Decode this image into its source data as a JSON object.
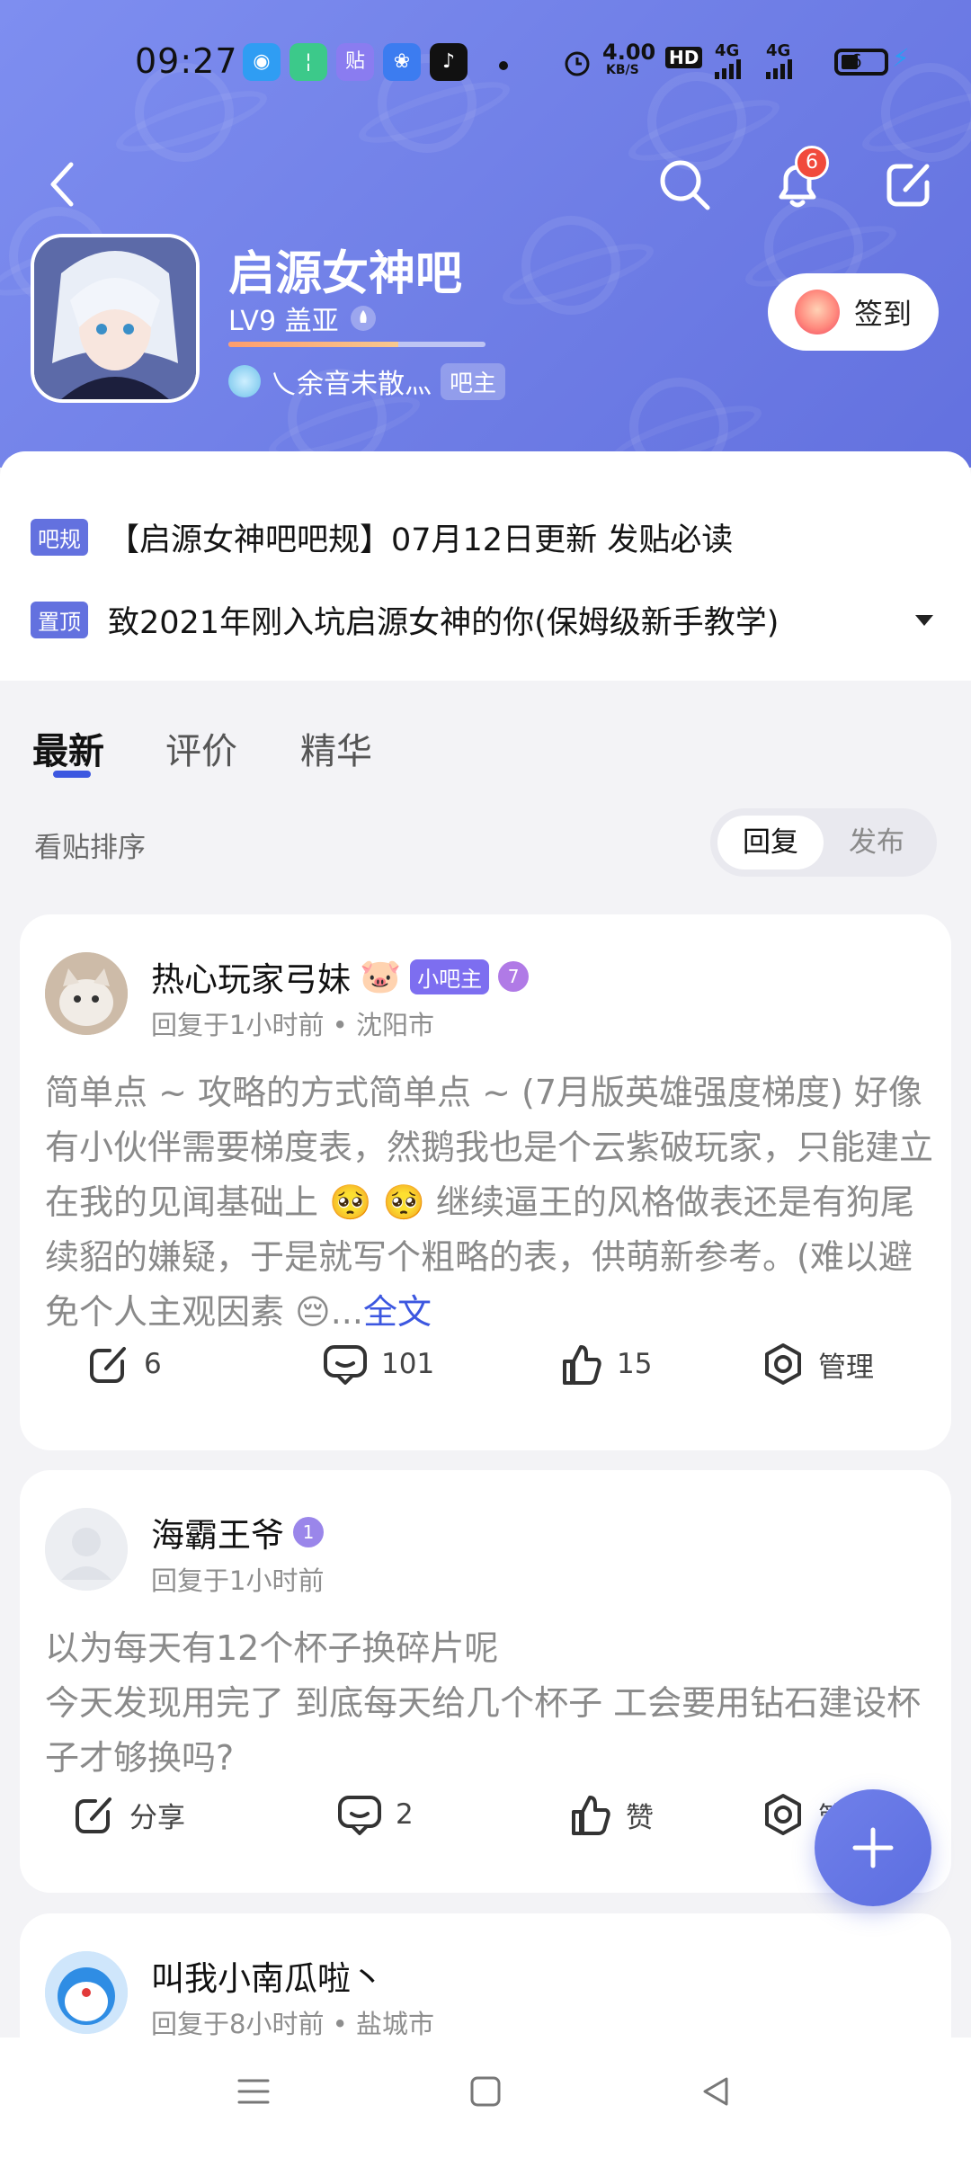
{
  "status": {
    "time": "09:27",
    "net_speed": "4.00",
    "net_unit": "KB/S",
    "hd": "HD",
    "sig1": "4G",
    "sig2": "4G",
    "battery": "6",
    "app_icons": [
      {
        "name": "app-blue-icon",
        "color": "#2f9df3",
        "glyph": "◉"
      },
      {
        "name": "app-green-icon",
        "color": "#3cc98a",
        "glyph": "¦"
      },
      {
        "name": "app-tieba-icon",
        "color": "#8a7cf0",
        "glyph": "贴"
      },
      {
        "name": "app-baidu-icon",
        "color": "#3c7cf0",
        "glyph": "❀"
      },
      {
        "name": "app-tiktok-icon",
        "color": "#111111",
        "glyph": "♪"
      }
    ]
  },
  "header": {
    "title": "启源女神吧",
    "level": "LV9 盖亚",
    "level_progress": 0.66,
    "admin_name": "乀余音未散灬",
    "admin_tag": "吧主",
    "notif_count": "6",
    "signin": "签到"
  },
  "notices": [
    {
      "tag": "吧规",
      "text": "【启源女神吧吧规】07月12日更新 发贴必读"
    },
    {
      "tag": "置顶",
      "text": "致2021年刚入坑启源女神的你(保姆级新手教学)"
    }
  ],
  "tabs": [
    "最新",
    "评价",
    "精华"
  ],
  "sort": {
    "label": "看贴排序",
    "options": [
      "回复",
      "发布"
    ]
  },
  "posts": [
    {
      "author": "热心玩家弓妹",
      "emoji": "🐷",
      "mod_tag": "小吧主",
      "level": "7",
      "level_color": "#b07ae6",
      "meta": "回复于1小时前 • 沈阳市",
      "body": "简单点 ~ 攻略的方式简单点 ~ (7月版英雄强度梯度) 好像有小伙伴需要梯度表，然鹅我也是个云紫破玩家，只能建立在我的见闻基础上 🥺 🥺 继续逼王的风格做表还是有狗尾续貂的嫌疑，于是就写个粗略的表，供萌新参考。(难以避免个人主观因素 😔...",
      "read_more": "全文",
      "actions": [
        "6",
        "101",
        "15",
        "管理"
      ]
    },
    {
      "author": "海霸王爷",
      "level": "1",
      "level_color": "#9a86ea",
      "meta": "回复于1小时前",
      "body": "以为每天有12个杯子换碎片呢\n今天发现用完了 到底每天给几个杯子 工会要用钻石建设杯子才够换吗?",
      "actions": [
        "分享",
        "2",
        "赞",
        "管理"
      ]
    },
    {
      "author": "叫我小南瓜啦丶",
      "meta": "回复于8小时前 • 盐城市"
    }
  ]
}
